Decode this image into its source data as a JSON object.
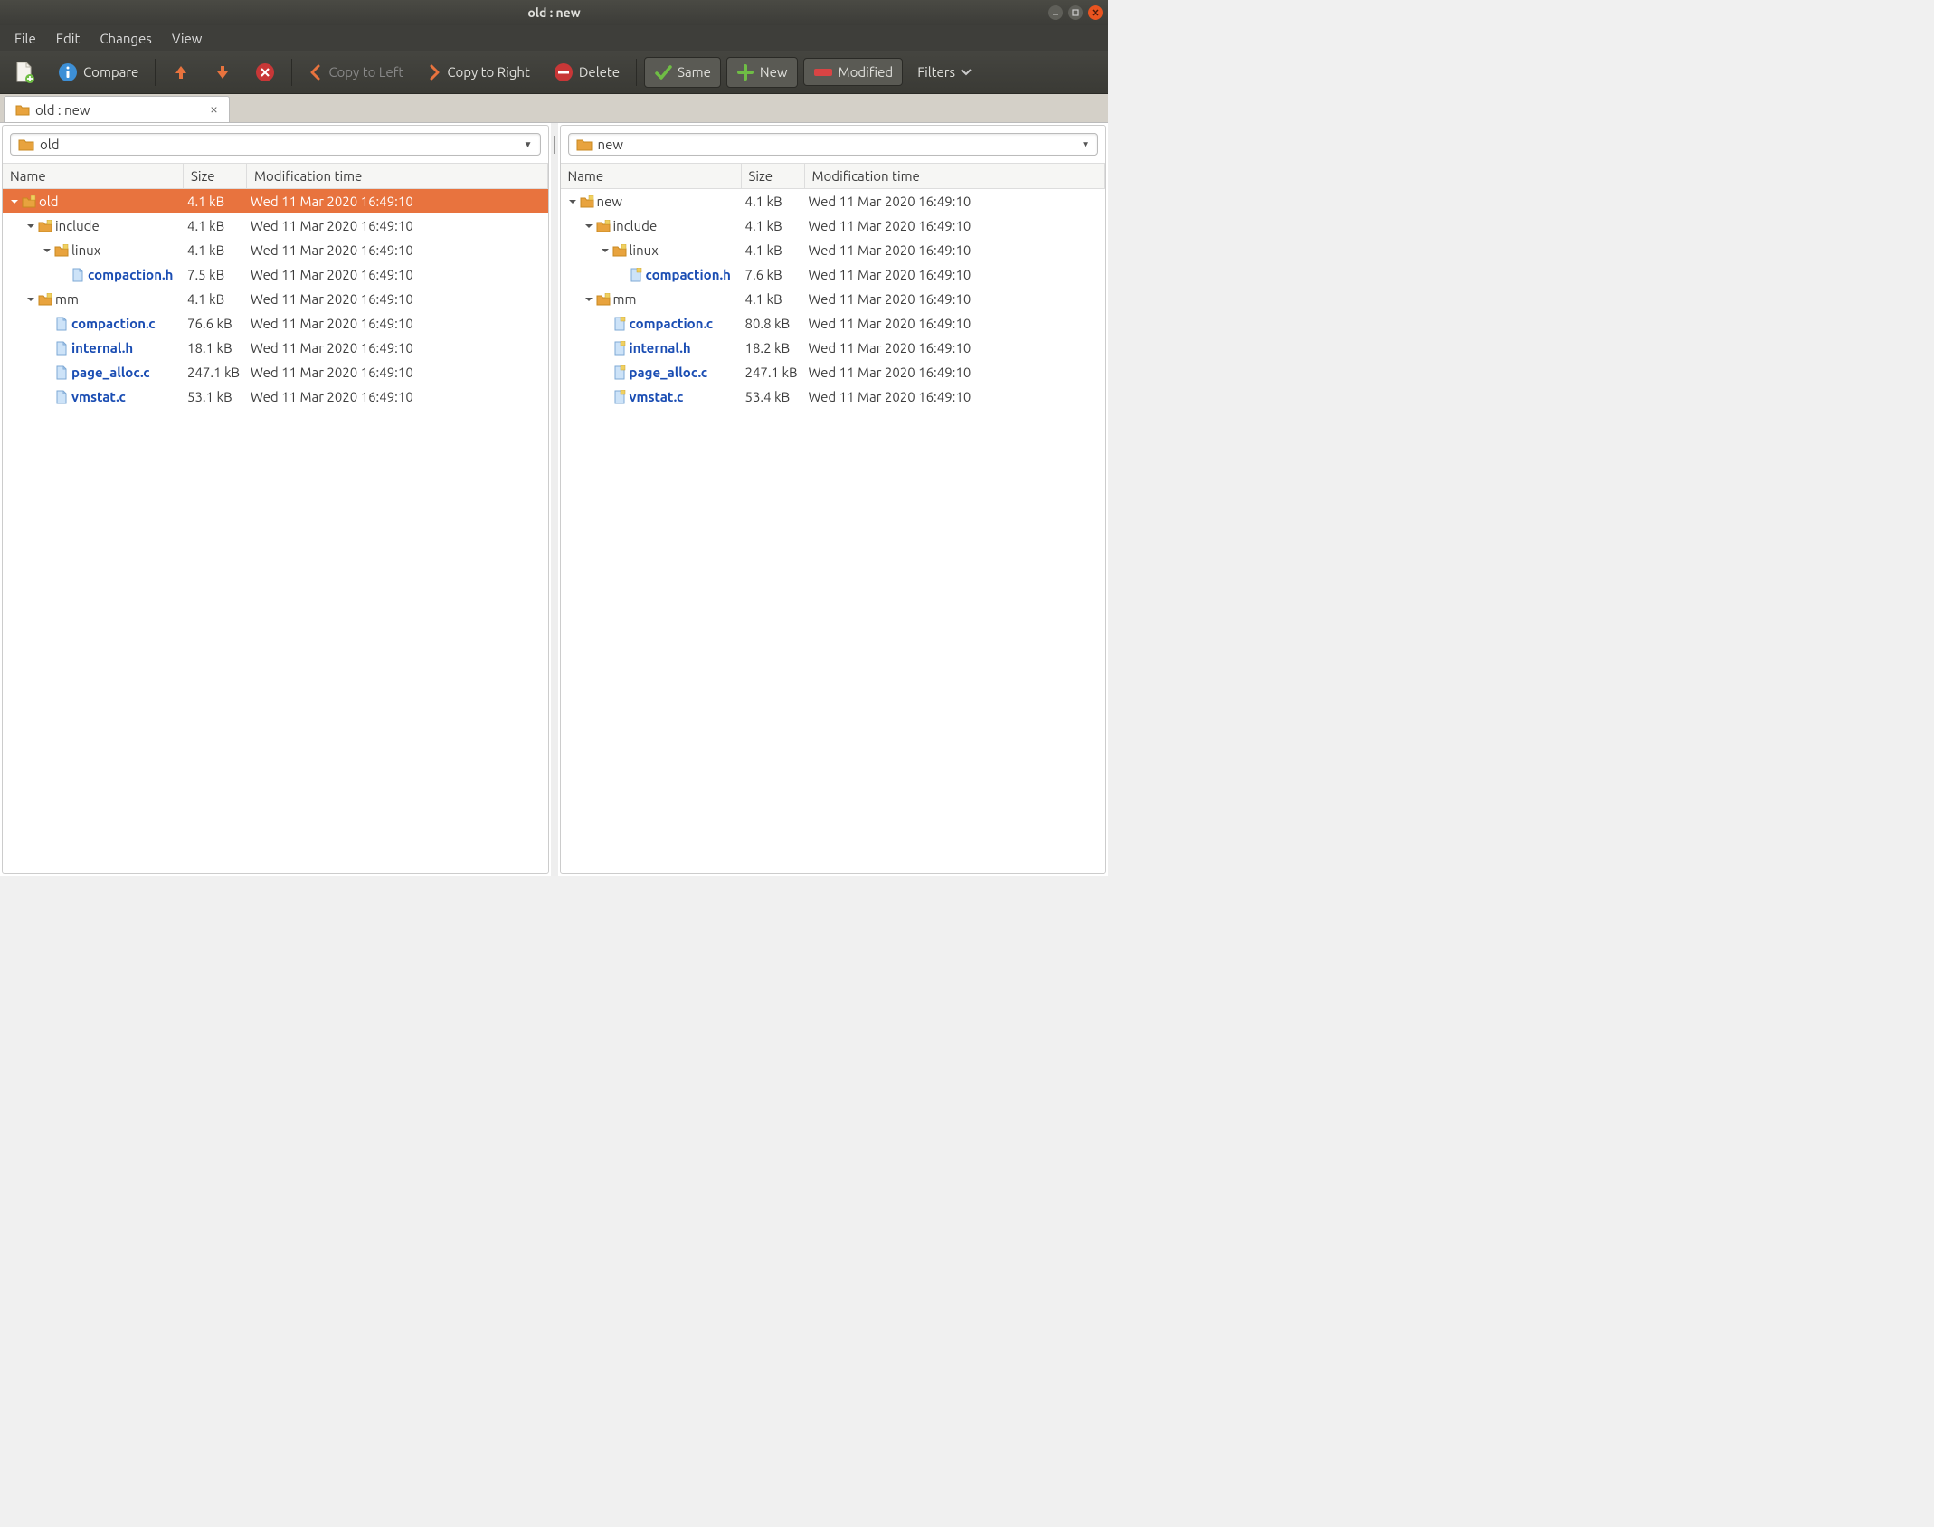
{
  "window": {
    "title": "old : new"
  },
  "menu": {
    "file": "File",
    "edit": "Edit",
    "changes": "Changes",
    "view": "View"
  },
  "toolbar": {
    "compare": "Compare",
    "copy_left": "Copy to Left",
    "copy_right": "Copy to Right",
    "delete": "Delete",
    "same": "Same",
    "new": "New",
    "modified": "Modified",
    "filters": "Filters"
  },
  "tab": {
    "label": "old : new"
  },
  "columns": {
    "name": "Name",
    "size": "Size",
    "mod": "Modification time"
  },
  "left": {
    "path": "old",
    "rows": [
      {
        "indent": 0,
        "expander": "down",
        "icon": "folder-mod",
        "name": "old",
        "size": "4.1 kB",
        "mod": "Wed 11 Mar 2020 16:49:10",
        "modified": false,
        "selected": true
      },
      {
        "indent": 1,
        "expander": "down",
        "icon": "folder-mod",
        "name": "include",
        "size": "4.1 kB",
        "mod": "Wed 11 Mar 2020 16:49:10",
        "modified": false
      },
      {
        "indent": 2,
        "expander": "down",
        "icon": "folder-mod",
        "name": "linux",
        "size": "4.1 kB",
        "mod": "Wed 11 Mar 2020 16:49:10",
        "modified": false
      },
      {
        "indent": 3,
        "expander": "none",
        "icon": "file",
        "name": "compaction.h",
        "size": "7.5 kB",
        "mod": "Wed 11 Mar 2020 16:49:10",
        "modified": true
      },
      {
        "indent": 1,
        "expander": "down",
        "icon": "folder-mod",
        "name": "mm",
        "size": "4.1 kB",
        "mod": "Wed 11 Mar 2020 16:49:10",
        "modified": false
      },
      {
        "indent": 2,
        "expander": "none",
        "icon": "file",
        "name": "compaction.c",
        "size": "76.6 kB",
        "mod": "Wed 11 Mar 2020 16:49:10",
        "modified": true
      },
      {
        "indent": 2,
        "expander": "none",
        "icon": "file",
        "name": "internal.h",
        "size": "18.1 kB",
        "mod": "Wed 11 Mar 2020 16:49:10",
        "modified": true
      },
      {
        "indent": 2,
        "expander": "none",
        "icon": "file",
        "name": "page_alloc.c",
        "size": "247.1 kB",
        "mod": "Wed 11 Mar 2020 16:49:10",
        "modified": true
      },
      {
        "indent": 2,
        "expander": "none",
        "icon": "file",
        "name": "vmstat.c",
        "size": "53.1 kB",
        "mod": "Wed 11 Mar 2020 16:49:10",
        "modified": true
      }
    ]
  },
  "right": {
    "path": "new",
    "rows": [
      {
        "indent": 0,
        "expander": "down",
        "icon": "folder-mod",
        "name": "new",
        "size": "4.1 kB",
        "mod": "Wed 11 Mar 2020 16:49:10",
        "modified": false
      },
      {
        "indent": 1,
        "expander": "down",
        "icon": "folder-mod",
        "name": "include",
        "size": "4.1 kB",
        "mod": "Wed 11 Mar 2020 16:49:10",
        "modified": false
      },
      {
        "indent": 2,
        "expander": "down",
        "icon": "folder-mod",
        "name": "linux",
        "size": "4.1 kB",
        "mod": "Wed 11 Mar 2020 16:49:10",
        "modified": false
      },
      {
        "indent": 3,
        "expander": "none",
        "icon": "file-mod",
        "name": "compaction.h",
        "size": "7.6 kB",
        "mod": "Wed 11 Mar 2020 16:49:10",
        "modified": true
      },
      {
        "indent": 1,
        "expander": "down",
        "icon": "folder-mod",
        "name": "mm",
        "size": "4.1 kB",
        "mod": "Wed 11 Mar 2020 16:49:10",
        "modified": false
      },
      {
        "indent": 2,
        "expander": "none",
        "icon": "file-mod",
        "name": "compaction.c",
        "size": "80.8 kB",
        "mod": "Wed 11 Mar 2020 16:49:10",
        "modified": true
      },
      {
        "indent": 2,
        "expander": "none",
        "icon": "file-mod",
        "name": "internal.h",
        "size": "18.2 kB",
        "mod": "Wed 11 Mar 2020 16:49:10",
        "modified": true
      },
      {
        "indent": 2,
        "expander": "none",
        "icon": "file-mod",
        "name": "page_alloc.c",
        "size": "247.1 kB",
        "mod": "Wed 11 Mar 2020 16:49:10",
        "modified": true
      },
      {
        "indent": 2,
        "expander": "none",
        "icon": "file-mod",
        "name": "vmstat.c",
        "size": "53.4 kB",
        "mod": "Wed 11 Mar 2020 16:49:10",
        "modified": true
      }
    ]
  }
}
